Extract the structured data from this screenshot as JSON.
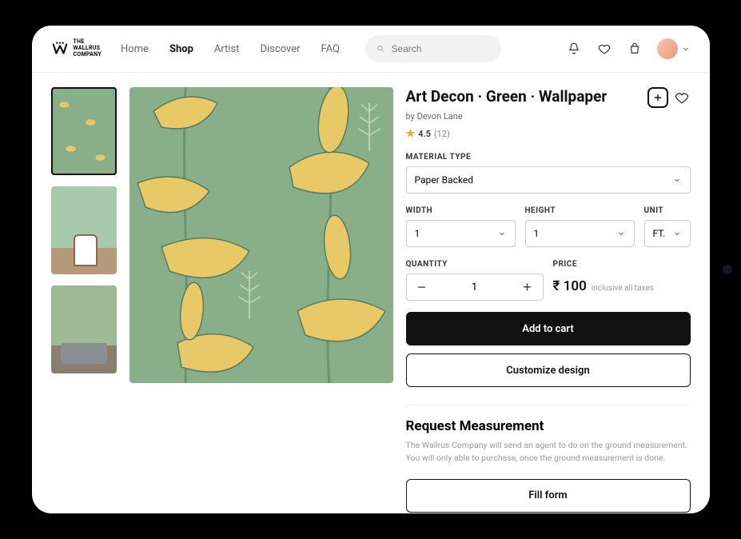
{
  "brand": {
    "line1": "THE",
    "line2": "WALLRUS",
    "line3": "COMPANY"
  },
  "nav": {
    "items": [
      {
        "label": "Home"
      },
      {
        "label": "Shop"
      },
      {
        "label": "Artist"
      },
      {
        "label": "Discover"
      },
      {
        "label": "FAQ"
      }
    ],
    "active_index": 1
  },
  "search": {
    "placeholder": "Search"
  },
  "product": {
    "title": "Art Decon · Green · Wallpaper",
    "by_prefix": "by",
    "artist": "Devon Lane",
    "rating_value": "4.5",
    "rating_count": "(12)"
  },
  "material": {
    "label": "MATERIAL TYPE",
    "selected": "Paper Backed"
  },
  "dimensions": {
    "width_label": "WIDTH",
    "width_value": "1",
    "height_label": "HEIGHT",
    "height_value": "1",
    "unit_label": "UNIT",
    "unit_value": "FT."
  },
  "quantity": {
    "label": "QUANTITY",
    "value": "1"
  },
  "price": {
    "label": "PRICE",
    "currency": "₹",
    "amount": "100",
    "note": "inclusive all taxes"
  },
  "buttons": {
    "add_to_cart": "Add to cart",
    "customize": "Customize design",
    "fill_form": "Fill form"
  },
  "request": {
    "title": "Request Measurement",
    "desc": "The Wallrus Company will send an agent to do on the ground measurement. You will only able to purchase, once the ground measurement is done."
  }
}
